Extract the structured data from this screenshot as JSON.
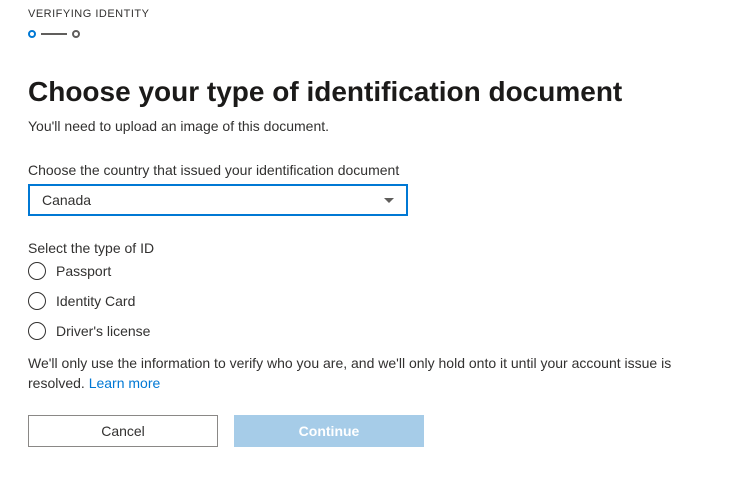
{
  "header": {
    "label": "VERIFYING IDENTITY"
  },
  "page": {
    "title": "Choose your type of identification document",
    "subtitle": "You'll need to upload an image of this document."
  },
  "country": {
    "label": "Choose the country that issued your identification document",
    "value": "Canada"
  },
  "idType": {
    "label": "Select the type of ID",
    "options": [
      {
        "label": "Passport"
      },
      {
        "label": "Identity Card"
      },
      {
        "label": "Driver's license"
      }
    ]
  },
  "disclaimer": {
    "text": "We'll only use the information to verify who you are, and we'll only hold onto it until your account issue is resolved. ",
    "linkText": "Learn more"
  },
  "buttons": {
    "cancel": "Cancel",
    "continue": "Continue"
  }
}
